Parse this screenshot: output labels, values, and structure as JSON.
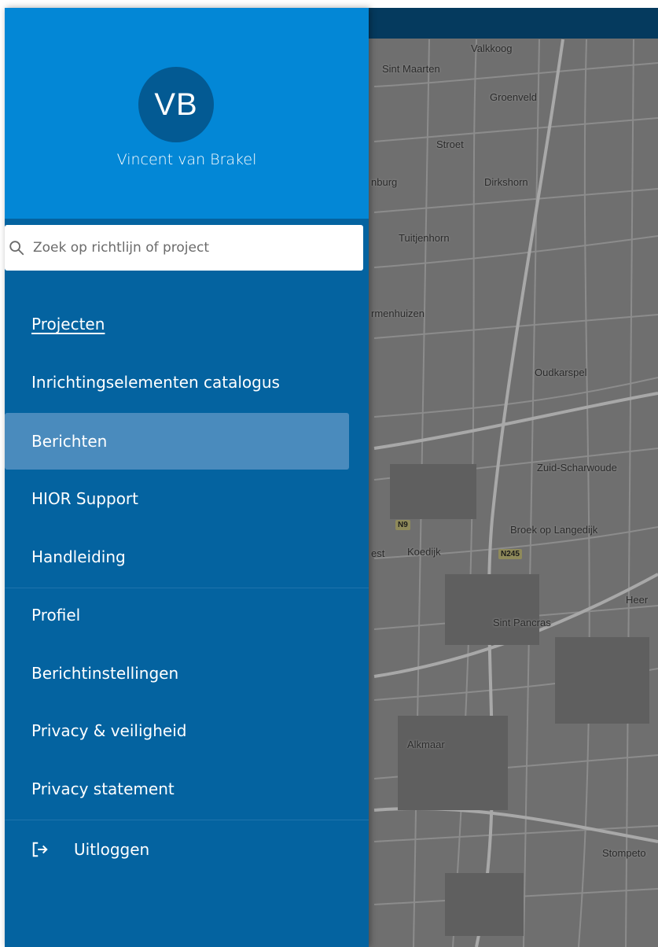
{
  "user": {
    "initials": "VB",
    "name": "Vincent van Brakel"
  },
  "search": {
    "placeholder": "Zoek op richtlijn of project",
    "value": ""
  },
  "menu": {
    "items": [
      {
        "label": "Projecten"
      },
      {
        "label": "Inrichtingselementen catalogus"
      },
      {
        "label": "Berichten"
      },
      {
        "label": "HIOR Support"
      },
      {
        "label": "Handleiding"
      },
      {
        "label": "Profiel"
      },
      {
        "label": "Berichtinstellingen"
      },
      {
        "label": "Privacy & veiligheid"
      },
      {
        "label": "Privacy statement"
      }
    ],
    "logout_label": "Uitloggen"
  },
  "map": {
    "places": [
      "Valkkoog",
      "Sint Maarten",
      "Groenveld",
      "Stroet",
      "Dirkshorn",
      "nburg",
      "Tuitjenhorn",
      "rmenhuizen",
      "Oudkarspel",
      "Zuid-Scharwoude",
      "Broek op Langedijk",
      "Koedijk",
      "est",
      "Heer",
      "Sint Pancras",
      "Alkmaar",
      "Stompeto"
    ],
    "roads": [
      "N9",
      "N245"
    ]
  },
  "colors": {
    "drawer_bg": "#0463a0",
    "header_bg": "#0387d6",
    "highlight_bg": "#4a8bbd",
    "topbar_bg": "#053a5e"
  }
}
